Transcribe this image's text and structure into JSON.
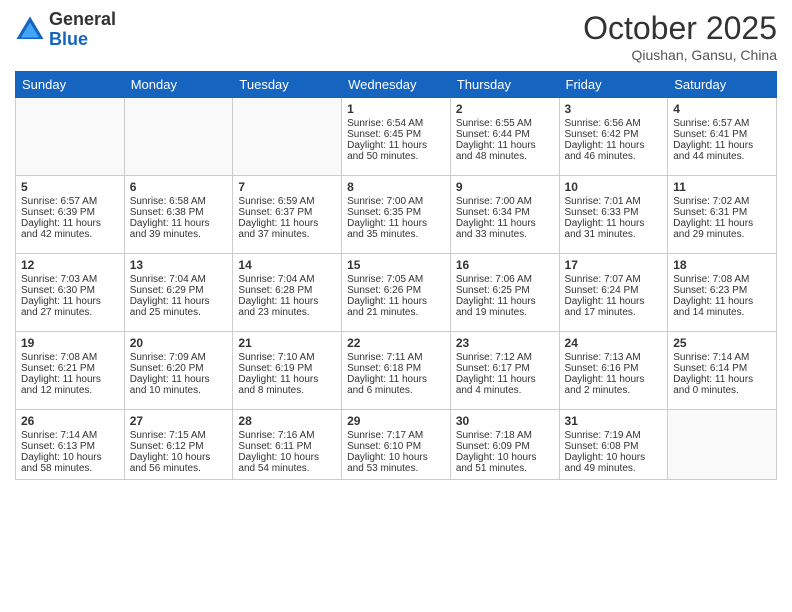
{
  "logo": {
    "general": "General",
    "blue": "Blue"
  },
  "header": {
    "month": "October 2025",
    "location": "Qiushan, Gansu, China"
  },
  "days": [
    "Sunday",
    "Monday",
    "Tuesday",
    "Wednesday",
    "Thursday",
    "Friday",
    "Saturday"
  ],
  "weeks": [
    [
      {
        "day": "",
        "content": ""
      },
      {
        "day": "",
        "content": ""
      },
      {
        "day": "",
        "content": ""
      },
      {
        "day": "1",
        "content": "Sunrise: 6:54 AM\nSunset: 6:45 PM\nDaylight: 11 hours\nand 50 minutes."
      },
      {
        "day": "2",
        "content": "Sunrise: 6:55 AM\nSunset: 6:44 PM\nDaylight: 11 hours\nand 48 minutes."
      },
      {
        "day": "3",
        "content": "Sunrise: 6:56 AM\nSunset: 6:42 PM\nDaylight: 11 hours\nand 46 minutes."
      },
      {
        "day": "4",
        "content": "Sunrise: 6:57 AM\nSunset: 6:41 PM\nDaylight: 11 hours\nand 44 minutes."
      }
    ],
    [
      {
        "day": "5",
        "content": "Sunrise: 6:57 AM\nSunset: 6:39 PM\nDaylight: 11 hours\nand 42 minutes."
      },
      {
        "day": "6",
        "content": "Sunrise: 6:58 AM\nSunset: 6:38 PM\nDaylight: 11 hours\nand 39 minutes."
      },
      {
        "day": "7",
        "content": "Sunrise: 6:59 AM\nSunset: 6:37 PM\nDaylight: 11 hours\nand 37 minutes."
      },
      {
        "day": "8",
        "content": "Sunrise: 7:00 AM\nSunset: 6:35 PM\nDaylight: 11 hours\nand 35 minutes."
      },
      {
        "day": "9",
        "content": "Sunrise: 7:00 AM\nSunset: 6:34 PM\nDaylight: 11 hours\nand 33 minutes."
      },
      {
        "day": "10",
        "content": "Sunrise: 7:01 AM\nSunset: 6:33 PM\nDaylight: 11 hours\nand 31 minutes."
      },
      {
        "day": "11",
        "content": "Sunrise: 7:02 AM\nSunset: 6:31 PM\nDaylight: 11 hours\nand 29 minutes."
      }
    ],
    [
      {
        "day": "12",
        "content": "Sunrise: 7:03 AM\nSunset: 6:30 PM\nDaylight: 11 hours\nand 27 minutes."
      },
      {
        "day": "13",
        "content": "Sunrise: 7:04 AM\nSunset: 6:29 PM\nDaylight: 11 hours\nand 25 minutes."
      },
      {
        "day": "14",
        "content": "Sunrise: 7:04 AM\nSunset: 6:28 PM\nDaylight: 11 hours\nand 23 minutes."
      },
      {
        "day": "15",
        "content": "Sunrise: 7:05 AM\nSunset: 6:26 PM\nDaylight: 11 hours\nand 21 minutes."
      },
      {
        "day": "16",
        "content": "Sunrise: 7:06 AM\nSunset: 6:25 PM\nDaylight: 11 hours\nand 19 minutes."
      },
      {
        "day": "17",
        "content": "Sunrise: 7:07 AM\nSunset: 6:24 PM\nDaylight: 11 hours\nand 17 minutes."
      },
      {
        "day": "18",
        "content": "Sunrise: 7:08 AM\nSunset: 6:23 PM\nDaylight: 11 hours\nand 14 minutes."
      }
    ],
    [
      {
        "day": "19",
        "content": "Sunrise: 7:08 AM\nSunset: 6:21 PM\nDaylight: 11 hours\nand 12 minutes."
      },
      {
        "day": "20",
        "content": "Sunrise: 7:09 AM\nSunset: 6:20 PM\nDaylight: 11 hours\nand 10 minutes."
      },
      {
        "day": "21",
        "content": "Sunrise: 7:10 AM\nSunset: 6:19 PM\nDaylight: 11 hours\nand 8 minutes."
      },
      {
        "day": "22",
        "content": "Sunrise: 7:11 AM\nSunset: 6:18 PM\nDaylight: 11 hours\nand 6 minutes."
      },
      {
        "day": "23",
        "content": "Sunrise: 7:12 AM\nSunset: 6:17 PM\nDaylight: 11 hours\nand 4 minutes."
      },
      {
        "day": "24",
        "content": "Sunrise: 7:13 AM\nSunset: 6:16 PM\nDaylight: 11 hours\nand 2 minutes."
      },
      {
        "day": "25",
        "content": "Sunrise: 7:14 AM\nSunset: 6:14 PM\nDaylight: 11 hours\nand 0 minutes."
      }
    ],
    [
      {
        "day": "26",
        "content": "Sunrise: 7:14 AM\nSunset: 6:13 PM\nDaylight: 10 hours\nand 58 minutes."
      },
      {
        "day": "27",
        "content": "Sunrise: 7:15 AM\nSunset: 6:12 PM\nDaylight: 10 hours\nand 56 minutes."
      },
      {
        "day": "28",
        "content": "Sunrise: 7:16 AM\nSunset: 6:11 PM\nDaylight: 10 hours\nand 54 minutes."
      },
      {
        "day": "29",
        "content": "Sunrise: 7:17 AM\nSunset: 6:10 PM\nDaylight: 10 hours\nand 53 minutes."
      },
      {
        "day": "30",
        "content": "Sunrise: 7:18 AM\nSunset: 6:09 PM\nDaylight: 10 hours\nand 51 minutes."
      },
      {
        "day": "31",
        "content": "Sunrise: 7:19 AM\nSunset: 6:08 PM\nDaylight: 10 hours\nand 49 minutes."
      },
      {
        "day": "",
        "content": ""
      }
    ]
  ]
}
